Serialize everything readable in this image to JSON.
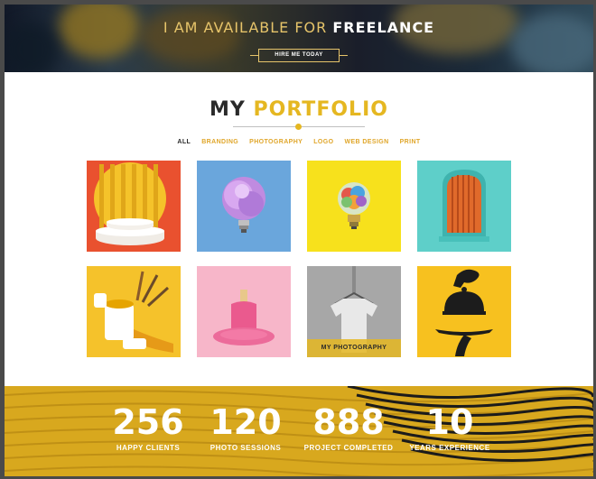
{
  "hero": {
    "title_prefix": "I AM AVAILABLE FOR",
    "title_strong": "FREELANCE",
    "cta_label": "HIRE ME TODAY"
  },
  "portfolio": {
    "heading_my": "MY",
    "heading_portfolio": "PORTFOLIO",
    "filters": [
      "ALL",
      "BRANDING",
      "PHOTOGRAPHY",
      "LOGO",
      "WEB DESIGN",
      "PRINT"
    ],
    "active_filter": "ALL",
    "items": [
      {
        "subject": "podium-arch"
      },
      {
        "subject": "fluffy-lightbulb"
      },
      {
        "subject": "brain-lightbulb"
      },
      {
        "subject": "teal-arch"
      },
      {
        "subject": "paint-buckets"
      },
      {
        "subject": "melting-popsicle"
      },
      {
        "subject": "tshirt-hanger",
        "overlay": "MY PHOTOGRAPHY"
      },
      {
        "subject": "serving-cloche"
      }
    ]
  },
  "stats": [
    {
      "value": "256",
      "label": "HAPPY CLIENTS"
    },
    {
      "value": "120",
      "label": "PHOTO SESSIONS"
    },
    {
      "value": "888",
      "label": "PROJECT COMPLETED"
    },
    {
      "value": "10",
      "label": "YEARS EXPERIENCE"
    }
  ],
  "colors": {
    "accent": "#e5b721",
    "dark": "#2a2a2a"
  }
}
